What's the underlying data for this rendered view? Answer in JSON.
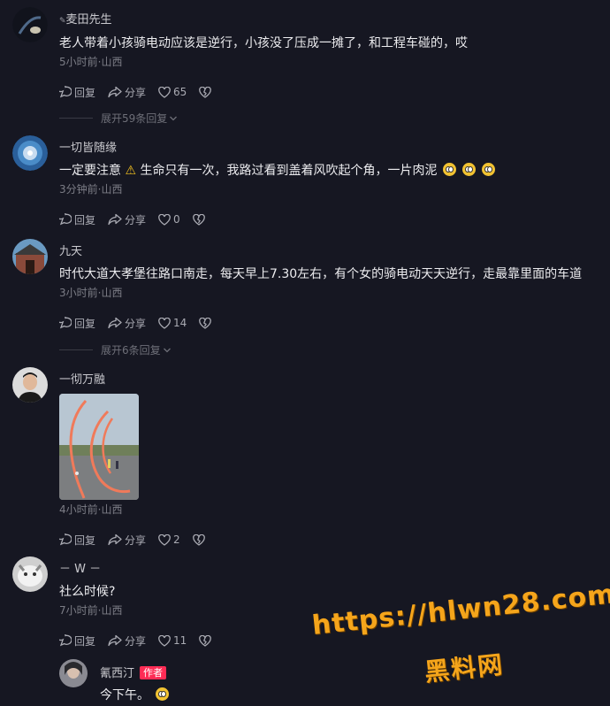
{
  "comments": [
    {
      "username": "麦田先生",
      "text": "老人带着小孩骑电动应该是逆行，小孩没了压成一摊了，和工程车碰的，哎",
      "meta": "5小时前·山西",
      "reply": "回复",
      "share": "分享",
      "likes": "65",
      "expand": "展开59条回复"
    },
    {
      "username": "一切皆随缘",
      "text_a": "一定要注意",
      "text_b": "生命只有一次，我路过看到盖着风吹起个角，一片肉泥",
      "meta": "3分钟前·山西",
      "reply": "回复",
      "share": "分享",
      "likes": "0"
    },
    {
      "username": "九天",
      "text": "时代大道大孝堡往路口南走，每天早上7.30左右，有个女的骑电动天天逆行，走最靠里面的车道",
      "meta": "3小时前·山西",
      "reply": "回复",
      "share": "分享",
      "likes": "14",
      "expand": "展开6条回复"
    },
    {
      "username": "一彻万融",
      "meta": "4小时前·山西",
      "reply": "回复",
      "share": "分享",
      "likes": "2"
    },
    {
      "username": "－ W －",
      "text": "社么时候?",
      "meta": "7小时前·山西",
      "reply": "回复",
      "share": "分享",
      "likes": "11"
    }
  ],
  "sub_reply": {
    "username": "氰西汀",
    "author_tag": "作者",
    "text": "今下午。"
  },
  "icons": {
    "reply": "comment-bubble-icon",
    "share": "share-arrow-icon",
    "like": "heart-icon",
    "dislike": "broken-heart-icon",
    "expand": "chevron-down-icon",
    "warning": "warning-emoji",
    "emoji": "pleading-face-emoji"
  },
  "watermark": {
    "url": "https://hlwn28.com",
    "name": "黑料网"
  },
  "colors": {
    "background": "#161722",
    "author_tag": "#fe2c55",
    "watermark": "#f5a51b"
  }
}
